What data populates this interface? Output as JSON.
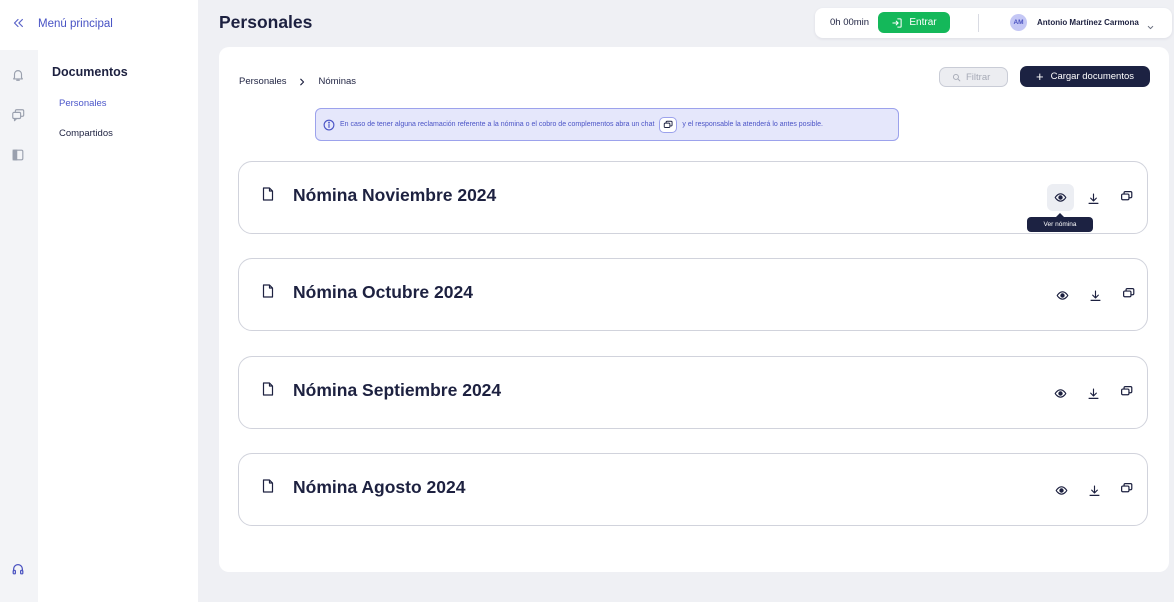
{
  "nav": {
    "menu_title": "Menú principal"
  },
  "sidebar": {
    "title": "Documentos",
    "items": [
      {
        "label": "Personales",
        "active": true
      },
      {
        "label": "Compartidos",
        "active": false
      }
    ]
  },
  "header": {
    "page_title": "Personales",
    "clock_time": "0h 00min",
    "enter_label": "Entrar",
    "user_initials": "AM",
    "user_name": "Antonio Martínez Carmona"
  },
  "breadcrumb": [
    "Personales",
    "Nóminas"
  ],
  "toolbar": {
    "filter_placeholder": "Filtrar",
    "upload_label": "Cargar documentos"
  },
  "info": {
    "text_before": "En caso de tener alguna reclamación referente a la nómina o el cobro de complementos abra un chat",
    "text_after": "y el responsable la atenderá lo antes posible."
  },
  "documents": [
    {
      "title": "Nómina Noviembre 2024"
    },
    {
      "title": "Nómina Octubre 2024"
    },
    {
      "title": "Nómina Septiembre 2024"
    },
    {
      "title": "Nómina Agosto 2024"
    }
  ],
  "tooltip": "Ver nómina",
  "icons": {
    "collapse": "double-chevron-left-icon",
    "bell": "bell-icon",
    "chat": "chat-icon",
    "panel": "sidebar-panel-icon",
    "support": "headset-icon",
    "document": "document-icon",
    "view": "eye-icon",
    "download": "download-icon",
    "filter": "search-icon"
  },
  "colors": {
    "accent": "#4b56c9",
    "primary_dark": "#1c2242",
    "success": "#14b85a",
    "info_bg": "#e5e7fb"
  }
}
